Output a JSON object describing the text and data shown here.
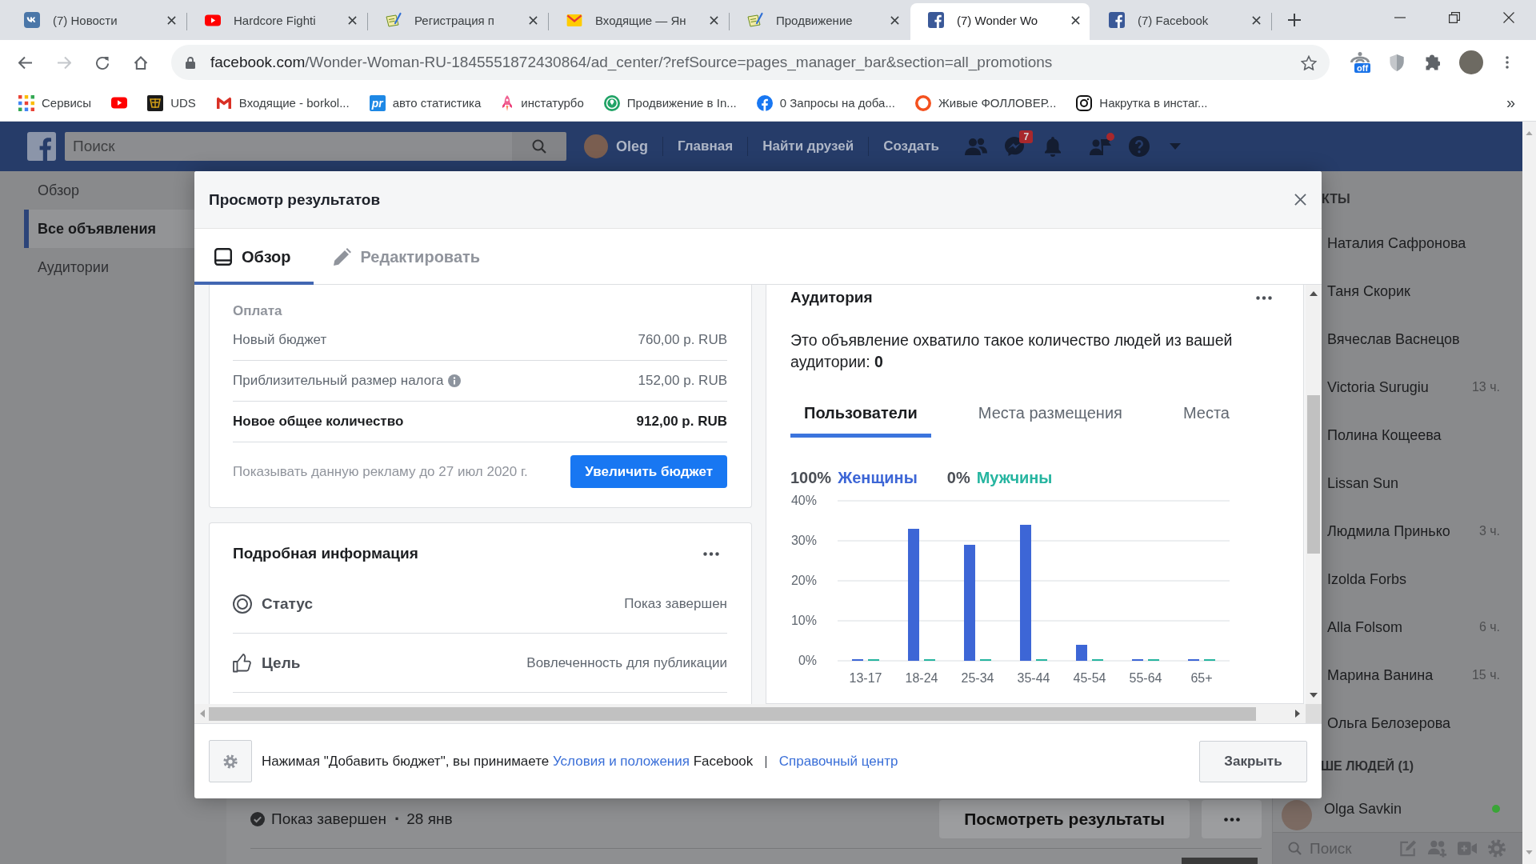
{
  "browser": {
    "tabs": [
      {
        "kind": "vk",
        "title": "(7) Новости",
        "selected": false
      },
      {
        "kind": "video",
        "title": "Hardcore Fighti",
        "selected": false
      },
      {
        "kind": "document",
        "title": "Регистрация п",
        "selected": false
      },
      {
        "kind": "mail",
        "title": "Входящие — Ян",
        "selected": false
      },
      {
        "kind": "document",
        "title": "Продвижение",
        "selected": false
      },
      {
        "kind": "facebook",
        "title": "(7) Wonder Wo",
        "selected": true
      },
      {
        "kind": "facebook",
        "title": "(7) Facebook",
        "selected": false
      }
    ],
    "forward_disabled": true,
    "url_host": "facebook.com",
    "url_path": "/Wonder-Woman-RU-1845551872430864/ad_center/?refSource=pages_manager_bar&section=all_promotions",
    "extensions": [
      {
        "kind": "antenna",
        "badge": "off"
      },
      {
        "kind": "shield"
      },
      {
        "kind": "puzzle"
      }
    ],
    "bookmarks": [
      {
        "kind": "apps",
        "label": "Сервисы"
      },
      {
        "kind": "video"
      },
      {
        "kind": "emblem",
        "label": "UDS"
      },
      {
        "kind": "gmail",
        "label": "Входящие - borkol..."
      },
      {
        "kind": "tile",
        "badge": "pr",
        "label": "авто статистика"
      },
      {
        "kind": "rocket",
        "label": "инстатурбо"
      },
      {
        "kind": "ring",
        "label": "Продвижение в In..."
      },
      {
        "kind": "facebook",
        "label": "0 Запросы на доба..."
      },
      {
        "kind": "circle",
        "label": "Живые ФОЛЛОВЕР..."
      },
      {
        "kind": "camera",
        "label": "Накрутка в инстаг..."
      }
    ],
    "bookmarks_more": "»"
  },
  "fb_header": {
    "search_placeholder": "Поиск",
    "user": "Oleg",
    "nav": [
      "Главная",
      "Найти друзей",
      "Создать"
    ],
    "messages_badge": "7",
    "requests_dot": true
  },
  "left_nav": [
    {
      "label": "Обзор",
      "selected": false
    },
    {
      "label": "Все объявления",
      "selected": true
    },
    {
      "label": "Аудитории",
      "selected": false
    }
  ],
  "post_row": {
    "status": "Показ завершен",
    "separator": "·",
    "date": "28 янв",
    "results_button": "Посмотреть результаты"
  },
  "chat": {
    "header": "КТЫ",
    "contacts": [
      {
        "name": "Наталия Сафронова"
      },
      {
        "name": "Таня Скорик"
      },
      {
        "name": "Вячеслав Васнецов"
      },
      {
        "name": "Victoria Surugiu",
        "time": "13 ч."
      },
      {
        "name": "Полина Кощеева"
      },
      {
        "name": "Lissan Sun"
      },
      {
        "name": "Людмила Принько",
        "time": "3 ч."
      },
      {
        "name": "Izolda Forbs"
      },
      {
        "name": "Alla Folsom",
        "time": "6 ч."
      },
      {
        "name": "Марина Ванина",
        "time": "15 ч."
      },
      {
        "name": "Ольга Белозерова"
      }
    ],
    "more_header": "ШЕ ЛЮДЕЙ (1)",
    "suggested": [
      {
        "name": "Olga Savkin",
        "online": true
      }
    ],
    "search_placeholder": "Поиск"
  },
  "modal": {
    "title": "Просмотр результатов",
    "tabs": [
      {
        "kind": "overview",
        "label": "Обзор",
        "selected": true
      },
      {
        "kind": "edit",
        "label": "Редактировать",
        "selected": false
      }
    ],
    "payment": {
      "heading": "Оплата",
      "rows": [
        {
          "label": "Новый бюджет",
          "value": "760,00 р. RUB",
          "info": false,
          "total": false
        },
        {
          "label": "Приблизительный размер налога",
          "value": "152,00 р. RUB",
          "info": true,
          "total": false
        },
        {
          "label": "Новое общее количество",
          "value": "912,00 р. RUB",
          "info": false,
          "total": true
        }
      ],
      "note": "Показывать данную рекламу до 27 июл 2020 г.",
      "button": "Увеличить бюджет"
    },
    "details": {
      "title": "Подробная информация",
      "rows": [
        {
          "kind": "status",
          "label": "Статус",
          "value": "Показ завершен"
        },
        {
          "kind": "goal",
          "label": "Цель",
          "value": "Вовлеченность для публикации"
        }
      ]
    },
    "audience": {
      "title": "Аудитория",
      "description": "Это объявление охватило такое количество людей из вашей аудитории: **0**",
      "tabs": [
        {
          "label": "Пользователи",
          "selected": true
        },
        {
          "label": "Места размещения",
          "selected": false
        },
        {
          "label": "Места",
          "selected": false
        }
      ],
      "legend_shares": [
        "100%",
        "0%"
      ],
      "chart_data": {
        "type": "bar",
        "categories": [
          "13-17",
          "18-24",
          "25-34",
          "35-44",
          "45-54",
          "55-64",
          "65+"
        ],
        "series": [
          {
            "name": "Женщины",
            "color": "#3d66d6",
            "values": [
              0,
              33,
              29,
              34,
              4,
              0,
              0
            ]
          },
          {
            "name": "Мужчины",
            "color": "#26b5a0",
            "values": [
              0,
              0,
              0,
              0,
              0,
              0,
              0
            ]
          }
        ],
        "ylim": [
          0,
          40
        ],
        "yticks": [
          {
            "value": 0,
            "label": "0%"
          },
          {
            "value": 10,
            "label": "10%"
          },
          {
            "value": 20,
            "label": "20%"
          },
          {
            "value": 30,
            "label": "30%"
          },
          {
            "value": 40,
            "label": "40%"
          }
        ],
        "grid": true
      }
    },
    "footer": {
      "text_before": "Нажимая \"Добавить бюджет\", вы принимаете",
      "terms_link": "Условия и положения",
      "text_after": "Facebook",
      "separator": "|",
      "help_link": "Справочный центр",
      "close_button": "Закрыть"
    }
  }
}
